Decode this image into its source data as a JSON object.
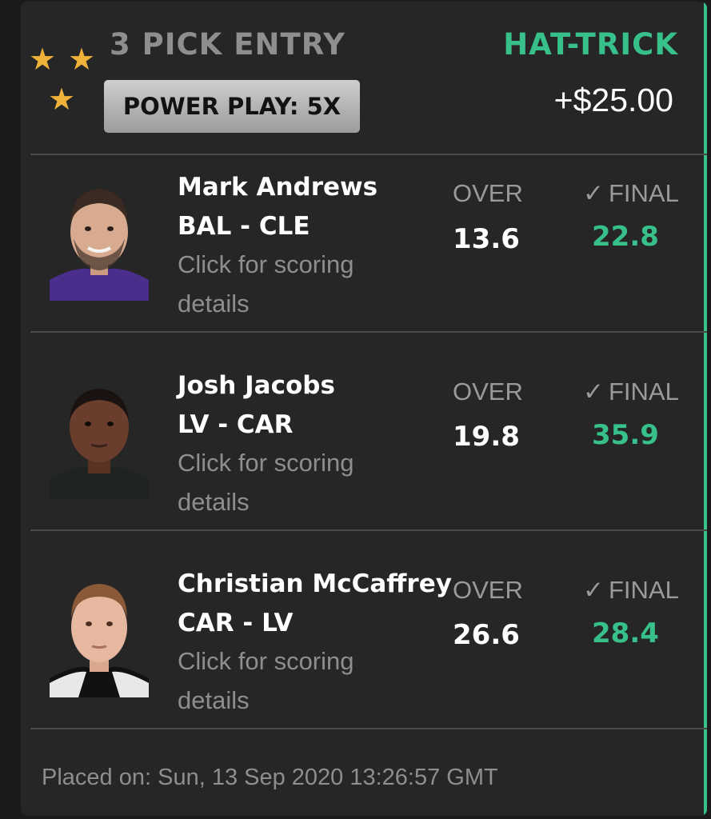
{
  "entry": {
    "title": "3 PICK ENTRY",
    "result": "HAT-TRICK",
    "power_play_label": "POWER PLAY: 5X",
    "payout": "+$25.00",
    "star_icon": "star-icon",
    "colors": {
      "accent_green": "#37c08a",
      "star_gold": "#f0b13a",
      "card_background": "#262626",
      "page_background": "#1b1b1b",
      "muted_text": "#8e8e8e"
    }
  },
  "picks": [
    {
      "player": "Mark Andrews",
      "matchup": "BAL - CLE",
      "details_link": "Click for scoring details",
      "direction": "OVER",
      "line": "13.6",
      "status": "FINAL",
      "final_value": "22.8",
      "jersey_color": "#4b2e8c"
    },
    {
      "player": "Josh Jacobs",
      "matchup": "LV - CAR",
      "details_link": "Click for scoring details",
      "direction": "OVER",
      "line": "19.8",
      "status": "FINAL",
      "final_value": "35.9",
      "jersey_color": "#1f2421"
    },
    {
      "player": "Christian McCaffrey",
      "matchup": "CAR - LV",
      "details_link": "Click for scoring details",
      "direction": "OVER",
      "line": "26.6",
      "status": "FINAL",
      "final_value": "28.4",
      "jersey_color": "#111111"
    }
  ],
  "footer": {
    "placed_on": "Placed on: Sun, 13 Sep 2020 13:26:57 GMT"
  }
}
